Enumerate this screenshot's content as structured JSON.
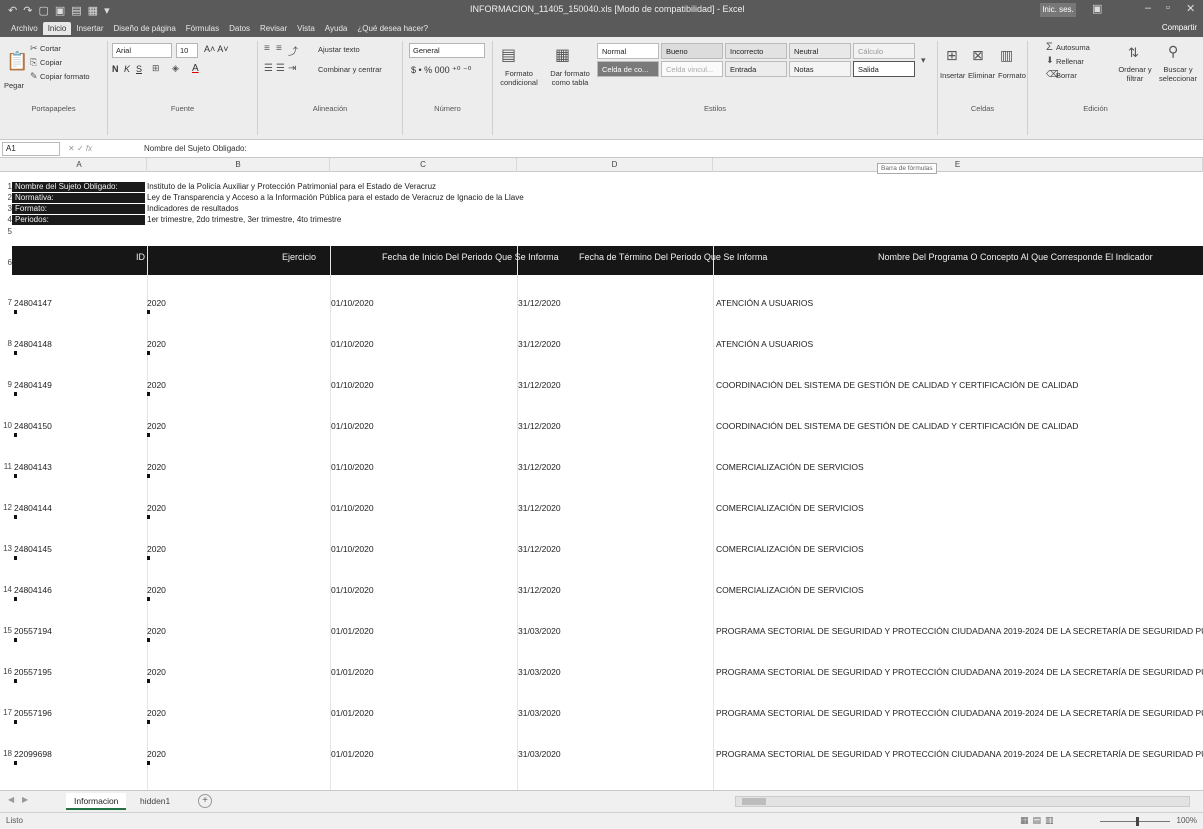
{
  "window": {
    "title": "INFORMACION_11405_150040.xls [Modo de compatibilidad] - Excel",
    "user": "Inic. ses.",
    "share_label": "Compartir"
  },
  "ribbon_tabs": [
    "Archivo",
    "Inicio",
    "Insertar",
    "Diseño de página",
    "Fórmulas",
    "Datos",
    "Revisar",
    "Vista",
    "Ayuda",
    "¿Qué desea hacer?"
  ],
  "ribbon": {
    "clipboard": {
      "cut": "Cortar",
      "copy": "Copiar",
      "paste": "Pegar",
      "format_painter": "Copiar formato",
      "label": "Portapapeles"
    },
    "font": {
      "name": "Arial",
      "size": "10",
      "label": "Fuente"
    },
    "alignment": {
      "wrap": "Ajustar texto",
      "merge": "Combinar y centrar",
      "label": "Alineación"
    },
    "number": {
      "format": "General",
      "label": "Número"
    },
    "styles": {
      "conditional": "Formato condicional",
      "as_table": "Dar formato como tabla",
      "cells": [
        "Normal",
        "Bueno",
        "Incorrecto",
        "Neutral",
        "Cálculo",
        "Celda de co...",
        "Celda vincul...",
        "Entrada",
        "Notas",
        "Salida"
      ],
      "label": "Estilos"
    },
    "cells_group": {
      "insert": "Insertar",
      "delete": "Eliminar",
      "format": "Formato",
      "label": "Celdas"
    },
    "editing": {
      "autosum": "Autosuma",
      "fill": "Rellenar",
      "clear": "Borrar",
      "sort": "Ordenar y filtrar",
      "find": "Buscar y seleccionar",
      "label": "Edición"
    }
  },
  "formula_bar": {
    "name_box": "A1",
    "fx": "fx",
    "content": "Nombre del Sujeto Obligado:",
    "tooltip": "Barra de fórmulas"
  },
  "columns": [
    "A",
    "B",
    "C",
    "D",
    "E"
  ],
  "meta": [
    {
      "row": "1",
      "label": "Nombre del Sujeto Obligado:",
      "value": "Instituto de la Policía Auxiliar y Protección Patrimonial para el Estado de Veracruz"
    },
    {
      "row": "2",
      "label": "Normativa:",
      "value": "Ley de Transparencia y Acceso a la Información Pública para el estado de Veracruz de Ignacio de la Llave"
    },
    {
      "row": "3",
      "label": "Formato:",
      "value": "Indicadores de resultados"
    },
    {
      "row": "4",
      "label": "Periodos:",
      "value": "1er trimestre, 2do trimestre, 3er trimestre, 4to trimestre"
    }
  ],
  "blank_row": "5",
  "header_row": "6",
  "headers": [
    "ID",
    "Ejercicio",
    "Fecha de Inicio Del Periodo Que Se Informa",
    "Fecha de Término Del Periodo Que Se Informa",
    "Nombre Del Programa O Concepto Al Que Corresponde El Indicador"
  ],
  "rows": [
    {
      "n": "7",
      "id": "24804147",
      "year": "2020",
      "start": "01/10/2020",
      "end": "31/12/2020",
      "program": "ATENCIÓN A USUARIOS"
    },
    {
      "n": "8",
      "id": "24804148",
      "year": "2020",
      "start": "01/10/2020",
      "end": "31/12/2020",
      "program": "ATENCIÓN A USUARIOS"
    },
    {
      "n": "9",
      "id": "24804149",
      "year": "2020",
      "start": "01/10/2020",
      "end": "31/12/2020",
      "program": "COORDINACIÓN DEL SISTEMA DE GESTIÓN DE CALIDAD Y CERTIFICACIÓN DE CALIDAD"
    },
    {
      "n": "10",
      "id": "24804150",
      "year": "2020",
      "start": "01/10/2020",
      "end": "31/12/2020",
      "program": "COORDINACIÓN DEL SISTEMA DE GESTIÓN DE CALIDAD Y CERTIFICACIÓN DE CALIDAD"
    },
    {
      "n": "11",
      "id": "24804143",
      "year": "2020",
      "start": "01/10/2020",
      "end": "31/12/2020",
      "program": "COMERCIALIZACIÓN DE SERVICIOS"
    },
    {
      "n": "12",
      "id": "24804144",
      "year": "2020",
      "start": "01/10/2020",
      "end": "31/12/2020",
      "program": "COMERCIALIZACIÓN DE SERVICIOS"
    },
    {
      "n": "13",
      "id": "24804145",
      "year": "2020",
      "start": "01/10/2020",
      "end": "31/12/2020",
      "program": "COMERCIALIZACIÓN DE SERVICIOS"
    },
    {
      "n": "14",
      "id": "24804146",
      "year": "2020",
      "start": "01/10/2020",
      "end": "31/12/2020",
      "program": "COMERCIALIZACIÓN DE SERVICIOS"
    },
    {
      "n": "15",
      "id": "20557194",
      "year": "2020",
      "start": "01/01/2020",
      "end": "31/03/2020",
      "program": "PROGRAMA SECTORIAL DE SEGURIDAD Y PROTECCIÓN CIUDADANA 2019-2024 DE LA SECRETARÍA DE SEGURIDAD PÚBI"
    },
    {
      "n": "16",
      "id": "20557195",
      "year": "2020",
      "start": "01/01/2020",
      "end": "31/03/2020",
      "program": "PROGRAMA SECTORIAL DE SEGURIDAD Y PROTECCIÓN CIUDADANA 2019-2024 DE LA SECRETARÍA DE SEGURIDAD PÚBI"
    },
    {
      "n": "17",
      "id": "20557196",
      "year": "2020",
      "start": "01/01/2020",
      "end": "31/03/2020",
      "program": "PROGRAMA SECTORIAL DE SEGURIDAD Y PROTECCIÓN CIUDADANA 2019-2024 DE LA SECRETARÍA DE SEGURIDAD PÚBI"
    },
    {
      "n": "18",
      "id": "22099698",
      "year": "2020",
      "start": "01/01/2020",
      "end": "31/03/2020",
      "program": "PROGRAMA SECTORIAL DE SEGURIDAD Y PROTECCIÓN CIUDADANA 2019-2024 DE LA SECRETARÍA DE SEGURIDAD PÚBI"
    }
  ],
  "sheet_tabs": [
    "Informacion",
    "hidden1"
  ],
  "status": {
    "text": "Listo",
    "zoom": "100%"
  }
}
